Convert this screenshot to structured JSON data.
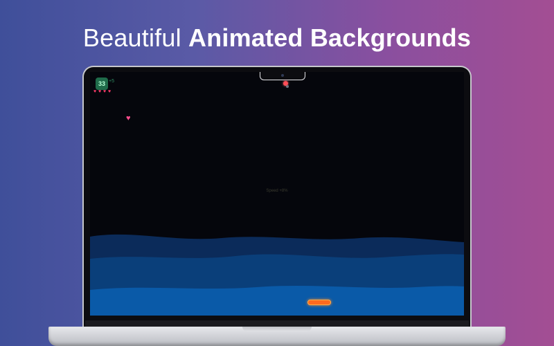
{
  "headline": {
    "regular": "Beautiful",
    "bold": "Animated Backgrounds"
  },
  "game": {
    "score": "33",
    "score_delta": "+5",
    "lives": [
      "♥",
      "♥",
      "♥",
      "♥"
    ],
    "speed_label": "Speed +8%",
    "powerup_icon": "heart-icon",
    "powerup_glyph": "♥"
  },
  "colors": {
    "background_left": "#3f4f9a",
    "background_right": "#a34e93",
    "screen_bg": "#05060c",
    "wave_dark": "#0b2b5a",
    "wave_mid": "#0a3f7a",
    "wave_front": "#0a5aa8",
    "paddle": "#ff6a1f",
    "ball": "#ff4d57",
    "heart": "#ff3b6b",
    "score_badge": "#1f6b4a"
  }
}
